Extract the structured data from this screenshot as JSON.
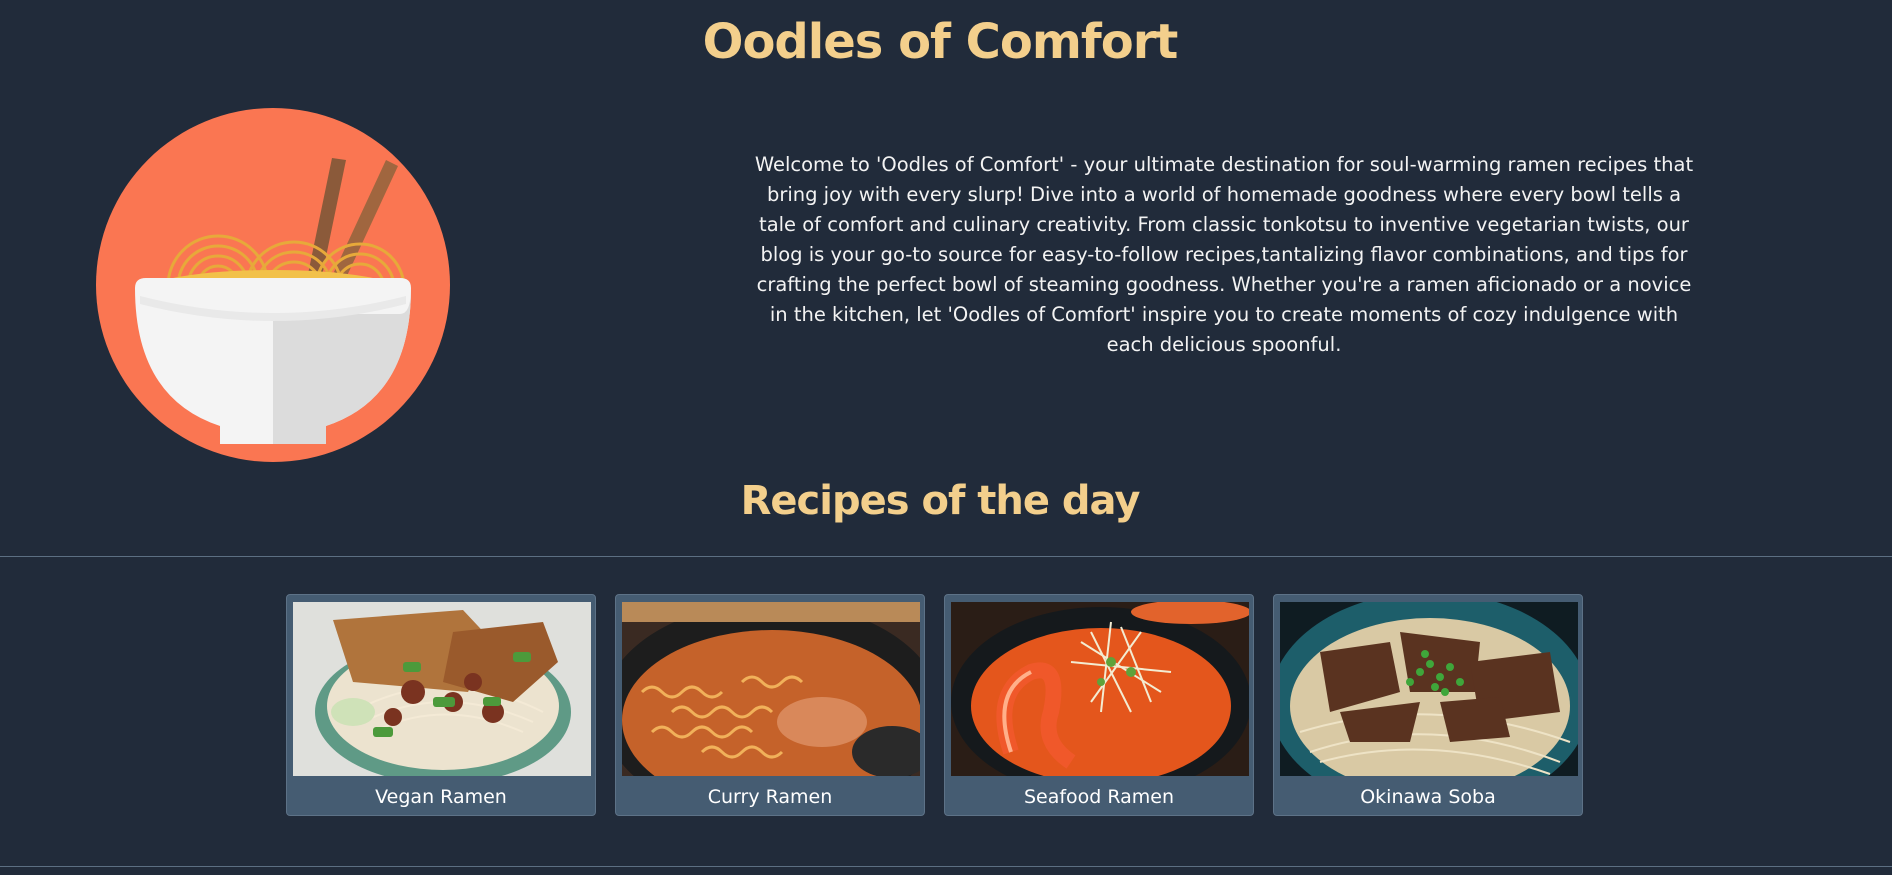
{
  "header": {
    "title": "Oodles of Comfort"
  },
  "logo": {
    "icon": "ramen-bowl-icon",
    "colors": {
      "circle": "#fa7652",
      "bowl": "#f4f4f4",
      "bowl_shade": "#dcdcdc",
      "noodles": "#f2c14a",
      "chopsticks": "#8b5a3a"
    }
  },
  "intro": {
    "text": "Welcome to 'Oodles of Comfort' - your ultimate destination for soul-warming ramen recipes that bring joy with every slurp! Dive into a world of homemade goodness where every bowl tells a tale of comfort and culinary creativity. From classic tonkotsu to inventive vegetarian twists, our blog is your go-to source for easy-to-follow recipes,tantalizing flavor combinations, and tips for crafting the perfect bowl of steaming goodness. Whether you're a ramen aficionado or a novice in the kitchen, let 'Oodles of Comfort' inspire you to create moments of cozy indulgence with each delicious spoonful."
  },
  "recipes_section": {
    "title": "Recipes of the day",
    "items": [
      {
        "name": "Vegan Ramen"
      },
      {
        "name": "Curry Ramen"
      },
      {
        "name": "Seafood Ramen"
      },
      {
        "name": "Okinawa Soba"
      }
    ]
  },
  "colors": {
    "background": "#212b3a",
    "heading": "#f3cf8c",
    "card": "#455c72"
  }
}
